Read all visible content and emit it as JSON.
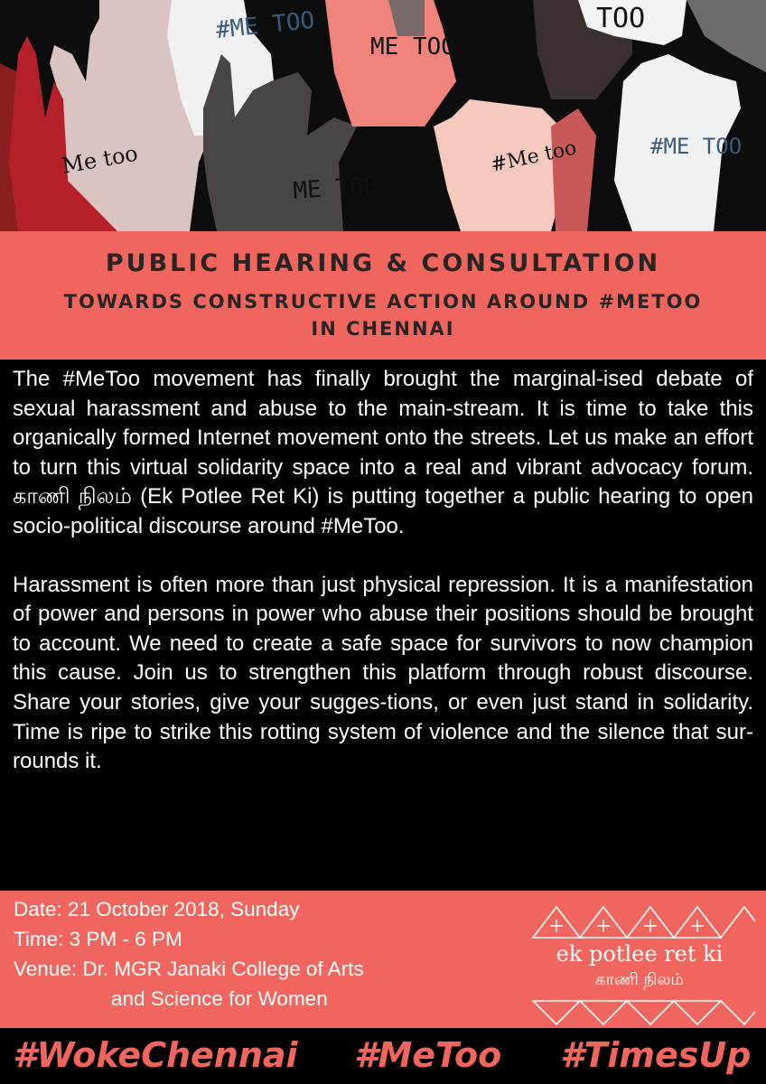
{
  "hero": {
    "hand_labels": [
      "#ME TOO",
      "ME TOO",
      "TOO",
      "Me too",
      "ME TOO",
      "#Me too",
      "#ME TOO"
    ]
  },
  "headline": {
    "line1": "PUBLIC HEARING & CONSULTATION",
    "line2": "TOWARDS CONSTRUCTIVE ACTION AROUND #METOO",
    "line3": "IN CHENNAI"
  },
  "body": {
    "paragraph1": "The #MeToo movement has finally brought the marginal-ised debate of sexual harassment and abuse to the main-stream. It is time to take this organically formed Internet movement onto the streets. Let us make an effort to turn this virtual solidarity space into a real and vibrant advocacy forum. காணி நிலம் (Ek Potlee Ret Ki) is putting together a public hearing to open socio-political discourse around #MeToo.",
    "paragraph2": "Harassment is often more than just physical repression. It is a manifestation of power and persons in power who abuse their positions should be brought to account. We need to create a safe space for survivors to now champion this cause. Join us to strengthen this platform through robust discourse. Share your stories, give your sugges-tions, or even just stand in solidarity. Time is ripe to strike this rotting system of violence and the silence that sur-rounds it."
  },
  "event": {
    "date": "Date: 21 October 2018, Sunday",
    "time": "Time: 3 PM - 6 PM",
    "venue_line1": "Venue: Dr. MGR Janaki College of Arts",
    "venue_line2": "and Science for Women"
  },
  "logo": {
    "name_en": "ek potlee ret ki",
    "name_ta": "காணி நிலம்"
  },
  "hashtags": [
    "#WokeChennai",
    "#MeToo",
    "#TimesUp"
  ],
  "colors": {
    "accent": "#f0665e",
    "background": "#000000",
    "headline_text": "#2a2525",
    "body_text": "#ffffff"
  }
}
